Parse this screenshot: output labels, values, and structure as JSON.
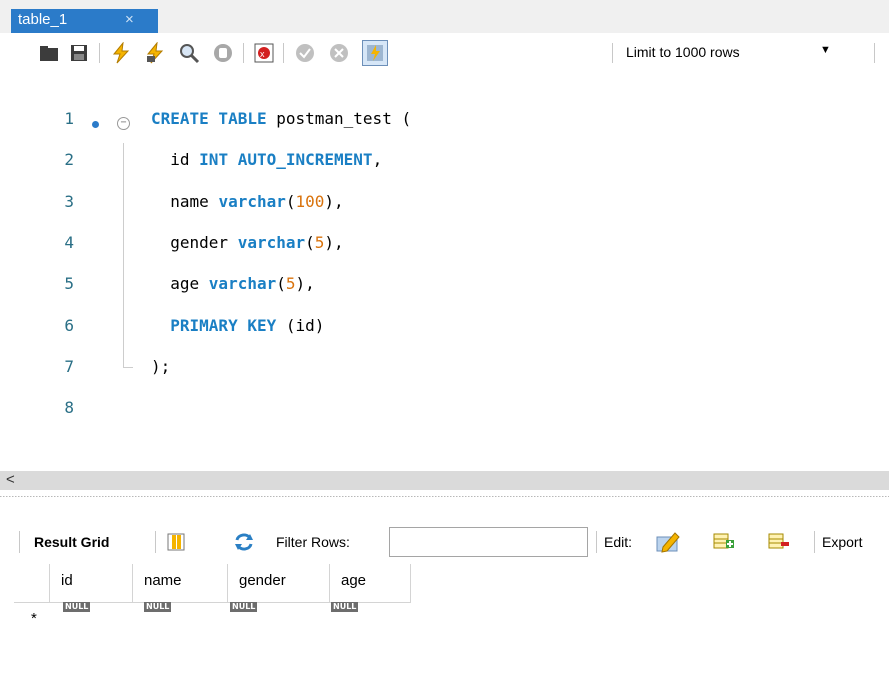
{
  "tab": {
    "label": "table_1",
    "close": "×"
  },
  "toolbar": {
    "limit_label": "Limit to 1000 rows",
    "limit_arrow": "▼"
  },
  "editor": {
    "lines": [
      {
        "num": "1",
        "tokens": [
          [
            "kw",
            "CREATE TABLE"
          ],
          [
            "p",
            " postman_test ("
          ]
        ]
      },
      {
        "num": "2",
        "tokens": [
          [
            "p",
            "  id "
          ],
          [
            "kw",
            "INT AUTO_INCREMENT"
          ],
          [
            "p",
            ","
          ]
        ]
      },
      {
        "num": "3",
        "tokens": [
          [
            "p",
            "  name "
          ],
          [
            "kw",
            "varchar"
          ],
          [
            "p",
            "("
          ],
          [
            "num",
            "100"
          ],
          [
            "p",
            "),"
          ]
        ]
      },
      {
        "num": "4",
        "tokens": [
          [
            "p",
            "  gender "
          ],
          [
            "kw",
            "varchar"
          ],
          [
            "p",
            "("
          ],
          [
            "num",
            "5"
          ],
          [
            "p",
            "),"
          ]
        ]
      },
      {
        "num": "5",
        "tokens": [
          [
            "p",
            "  age "
          ],
          [
            "kw",
            "varchar"
          ],
          [
            "p",
            "("
          ],
          [
            "num",
            "5"
          ],
          [
            "p",
            "),"
          ]
        ]
      },
      {
        "num": "6",
        "tokens": [
          [
            "kw",
            "  PRIMARY KEY"
          ],
          [
            "p",
            " (id)"
          ]
        ]
      },
      {
        "num": "7",
        "tokens": [
          [
            "p",
            ");"
          ]
        ]
      },
      {
        "num": "8",
        "tokens": []
      }
    ]
  },
  "scroll": {
    "left_arrow": "<"
  },
  "result": {
    "grid_label": "Result Grid",
    "filter_label": "Filter Rows:",
    "filter_value": "",
    "edit_label": "Edit:",
    "export_label": "Export"
  },
  "grid": {
    "columns": [
      "id",
      "name",
      "gender",
      "age"
    ],
    "null_text": "NULL",
    "new_row_marker": "*"
  },
  "colors": {
    "tab": "#2b7bc9",
    "keyword": "#1a7fc4",
    "number": "#d9730d",
    "line_number": "#2a6f86"
  }
}
